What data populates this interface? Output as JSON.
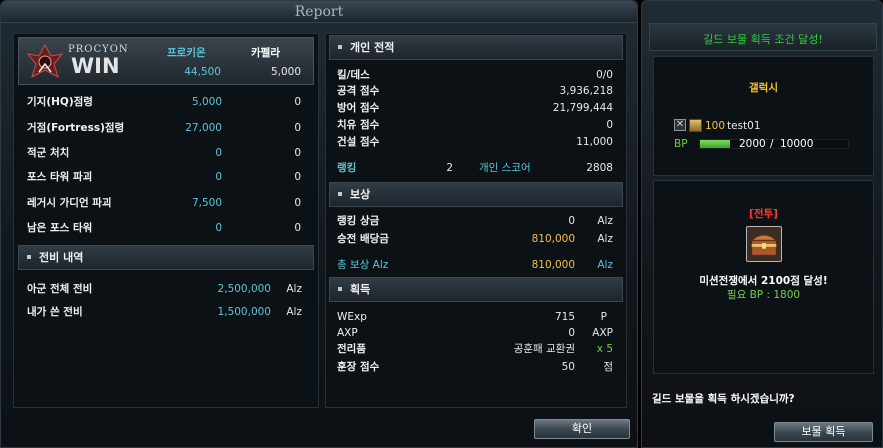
{
  "report": {
    "title": "Report",
    "logo": {
      "line1": "PROCYON",
      "line2": "WIN"
    },
    "factions": {
      "left_name": "프로키온",
      "left_score": "44,500",
      "right_name": "카펠라",
      "right_score": "5,000"
    },
    "stats": [
      {
        "label": "기지(HQ)점령",
        "left": "5,000",
        "right": "0"
      },
      {
        "label": "거점(Fortress)점령",
        "left": "27,000",
        "right": "0"
      },
      {
        "label": "적군 처치",
        "left": "0",
        "right": "0"
      },
      {
        "label": "포스 타워 파괴",
        "left": "0",
        "right": "0"
      },
      {
        "label": "레거시 가디언 파괴",
        "left": "7,500",
        "right": "0"
      },
      {
        "label": "남은 포스 타워",
        "left": "0",
        "right": "0"
      }
    ],
    "expense": {
      "header": "전비 내역",
      "rows": [
        {
          "label": "아군 전체 전비",
          "value": "2,500,000",
          "unit": "Alz"
        },
        {
          "label": "내가 쓴 전비",
          "value": "1,500,000",
          "unit": "Alz"
        }
      ]
    },
    "personal": {
      "header": "개인 전적",
      "rows": [
        {
          "label": "킬/데스",
          "value": "0/0"
        },
        {
          "label": "공격 점수",
          "value": "3,936,218"
        },
        {
          "label": "방어 점수",
          "value": "21,799,444"
        },
        {
          "label": "치유 점수",
          "value": "0"
        },
        {
          "label": "건설 점수",
          "value": "11,000"
        }
      ],
      "rank_label": "랭킹",
      "rank_value": "2",
      "score_label": "개인 스코어",
      "score_value": "2808"
    },
    "reward": {
      "header": "보상",
      "rows": [
        {
          "label": "랭킹 상금",
          "value": "0",
          "unit": "Alz"
        },
        {
          "label": "승전 배당금",
          "value": "810,000",
          "unit": "Alz"
        }
      ],
      "total_label": "총 보상 Alz",
      "total_value": "810,000",
      "total_unit": "Alz"
    },
    "gain": {
      "header": "획득",
      "rows": [
        {
          "label": "WExp",
          "value": "715",
          "unit": "P"
        },
        {
          "label": "AXP",
          "value": "0",
          "unit": "AXP"
        },
        {
          "label": "전리품",
          "value": "공훈패 교환권",
          "unit": "x 5"
        },
        {
          "label": "훈장 점수",
          "value": "50",
          "unit": "점"
        }
      ]
    },
    "confirm_label": "확인"
  },
  "guild": {
    "banner": "길드 보물 획득 조건 달성!",
    "name": "갤럭시",
    "member_level": "100",
    "member_name": "test01",
    "bp_label": "BP",
    "bp_current": "2000",
    "bp_sep": "/",
    "bp_max": "10000",
    "bp_ratio": 0.2,
    "mission_tag": "[전투]",
    "mission_text": "미션전쟁에서 2100점 달성!",
    "need_label": "필요 BP : 1800",
    "prompt": "길드 보물을 획득 하시겠습니까?",
    "acquire_label": "보물 획득"
  },
  "colors": {
    "cyan": "#5bc7d6",
    "gold": "#f0c24b",
    "green": "#6fd24a",
    "guild_banner": "#2ecf3a",
    "guild_name": "#ffbf2a",
    "battle_tag": "#ff3a3a"
  }
}
